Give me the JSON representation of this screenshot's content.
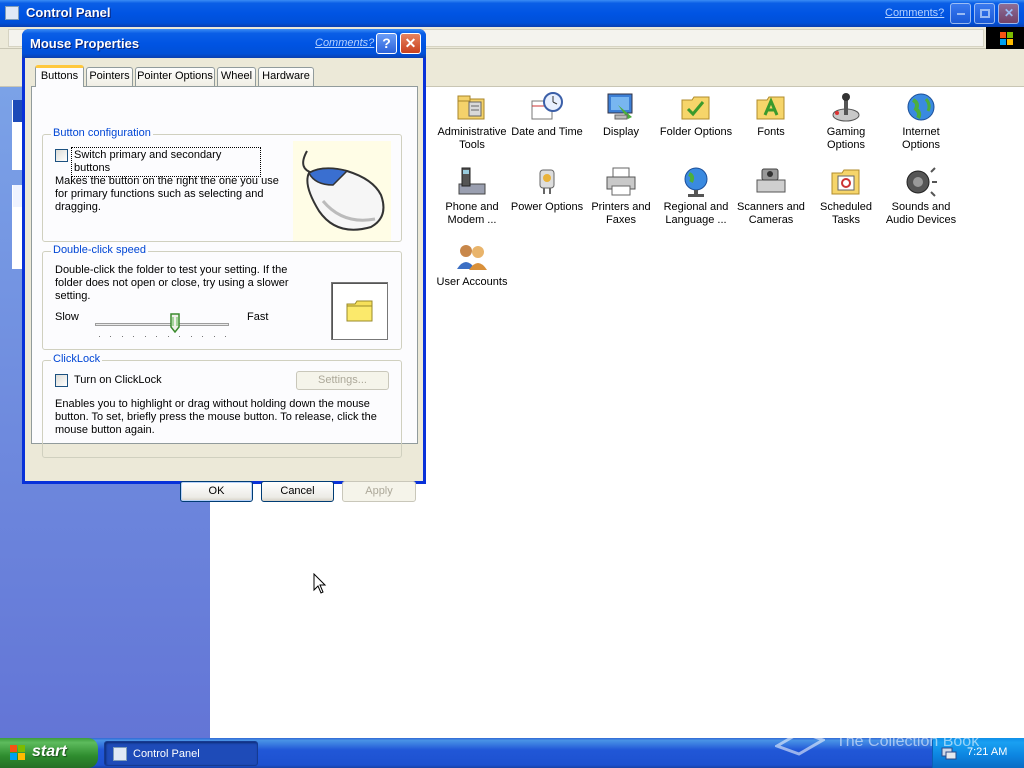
{
  "control_panel": {
    "title": "Control Panel",
    "comments_link": "Comments?",
    "icons": [
      {
        "label": "Administrative Tools",
        "icon": "admin-tools-icon"
      },
      {
        "label": "Date and Time",
        "icon": "clock-icon"
      },
      {
        "label": "Display",
        "icon": "display-icon"
      },
      {
        "label": "Folder Options",
        "icon": "folder-options-icon"
      },
      {
        "label": "Fonts",
        "icon": "fonts-folder-icon"
      },
      {
        "label": "Gaming Options",
        "icon": "joystick-icon"
      },
      {
        "label": "Internet Options",
        "icon": "globe-icon"
      },
      {
        "label": "Phone and Modem ...",
        "icon": "phone-icon"
      },
      {
        "label": "Power Options",
        "icon": "power-icon"
      },
      {
        "label": "Printers and Faxes",
        "icon": "printer-icon"
      },
      {
        "label": "Regional and Language ...",
        "icon": "regional-globe-icon"
      },
      {
        "label": "Scanners and Cameras",
        "icon": "scanner-icon"
      },
      {
        "label": "Scheduled Tasks",
        "icon": "scheduled-tasks-icon"
      },
      {
        "label": "Sounds and Audio Devices",
        "icon": "speaker-icon"
      },
      {
        "label": "User Accounts",
        "icon": "users-icon"
      }
    ]
  },
  "dialog": {
    "title": "Mouse Properties",
    "comments_link": "Comments?",
    "help_glyph": "?",
    "close_glyph": "✕",
    "tabs": [
      "Buttons",
      "Pointers",
      "Pointer Options",
      "Wheel",
      "Hardware"
    ],
    "active_tab": "Buttons",
    "button_config": {
      "group_label": "Button configuration",
      "checkbox_label": "Switch primary and secondary buttons",
      "checked": false,
      "description": "Makes the button on the right the one you use for primary functions such as selecting and dragging."
    },
    "double_click": {
      "group_label": "Double-click speed",
      "description": "Double-click the folder to test your setting. If the folder does not open or close, try using a slower setting.",
      "slow_label": "Slow",
      "fast_label": "Fast",
      "slider_value": 0.6
    },
    "clicklock": {
      "group_label": "ClickLock",
      "checkbox_label": "Turn on ClickLock",
      "checked": false,
      "settings_button": "Settings...",
      "description": "Enables you to highlight or drag without holding down the mouse button. To set, briefly press the mouse button. To release, click the mouse button again."
    },
    "buttons": {
      "ok": "OK",
      "cancel": "Cancel",
      "apply": "Apply"
    }
  },
  "taskbar": {
    "start_label": "start",
    "task_item": "Control Panel",
    "clock": "7:21 AM",
    "watermark": "The Collection Book"
  },
  "colors": {
    "xp_blue": "#0054e3",
    "sidebar_top": "#7ba2e7",
    "dialog_bg": "#ece9d8",
    "group_label": "#0046d5",
    "tab_highlight": "#ffc83c"
  }
}
